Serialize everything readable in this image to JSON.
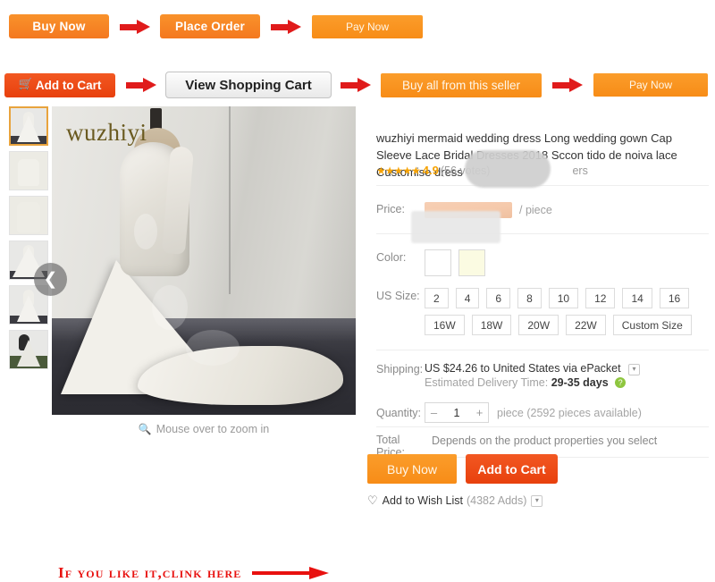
{
  "steps_row_1": [
    {
      "label": "Buy Now",
      "name": "buy-now-step-button",
      "style": "orange"
    },
    {
      "label": "Place Order",
      "name": "place-order-step-button",
      "style": "orange"
    },
    {
      "label": "Pay Now",
      "name": "pay-now-step-button",
      "style": "orange-light"
    }
  ],
  "steps_row_2": [
    {
      "label": "Add to Cart",
      "name": "add-to-cart-step-button",
      "style": "red"
    },
    {
      "label": "View Shopping Cart",
      "name": "view-shopping-cart-button",
      "style": "grey"
    },
    {
      "label": "Buy all from this seller",
      "name": "buy-all-from-seller-button",
      "style": "orange-light"
    },
    {
      "label": "Pay Now",
      "name": "pay-now-step-button-2",
      "style": "orange-light"
    }
  ],
  "gallery": {
    "watermark": "wuzhiyi",
    "zoom_hint": "Mouse over to zoom in",
    "zoom_icon": "search-icon",
    "prev_icon": "chevron-left-icon",
    "thumbnails": [
      {
        "name": "thumbnail-1",
        "selected": true,
        "kind": "full"
      },
      {
        "name": "thumbnail-2",
        "selected": false,
        "kind": "closeup"
      },
      {
        "name": "thumbnail-3",
        "selected": false,
        "kind": "closeup"
      },
      {
        "name": "thumbnail-4",
        "selected": false,
        "kind": "full"
      },
      {
        "name": "thumbnail-5",
        "selected": false,
        "kind": "full"
      },
      {
        "name": "thumbnail-6",
        "selected": false,
        "kind": "full"
      }
    ]
  },
  "annotation": {
    "text": "If you like it,clink here",
    "color": "#e8110f"
  },
  "product": {
    "title": "wuzhiyi mermaid wedding dress Long wedding gown Cap Sleeve Lace Bridal Dresses 2018 Sccon     tido de noiva lace Customise dress",
    "rating": {
      "stars": "★★★★★",
      "value": "4.9",
      "votes": "(56 votes)",
      "orders": "ers"
    },
    "price": {
      "label": "Price:",
      "value": "",
      "unit": "/ piece"
    },
    "color": {
      "label": "Color:",
      "swatches": [
        "#ffffff",
        "#fbfbe2"
      ]
    },
    "size": {
      "label": "US Size:",
      "options": [
        "2",
        "4",
        "6",
        "8",
        "10",
        "12",
        "14",
        "16",
        "16W",
        "18W",
        "20W",
        "22W",
        "Custom Size"
      ]
    },
    "shipping": {
      "label": "Shipping:",
      "value": "US $24.26 to United States via ePacket",
      "caret_icon": "chevron-down-icon",
      "delivery_label": "Estimated Delivery Time:",
      "delivery_days": "29-35 days",
      "help_icon": "question-mark-icon"
    },
    "quantity": {
      "label": "Quantity:",
      "minus": "–",
      "value": "1",
      "plus": "+",
      "stock": "piece (2592 pieces available)"
    },
    "total": {
      "label": "Total Price:",
      "value": "Depends on the product properties you select"
    },
    "actions": [
      {
        "label": "Buy Now",
        "name": "buy-now-button",
        "style": "orange-light"
      },
      {
        "label": "Add to Cart",
        "name": "add-to-cart-button",
        "style": "red"
      }
    ],
    "wishlist": {
      "heart_icon": "heart-icon",
      "label": "Add to Wish List",
      "count": "(4382 Adds)",
      "caret_icon": "chevron-down-icon"
    }
  }
}
